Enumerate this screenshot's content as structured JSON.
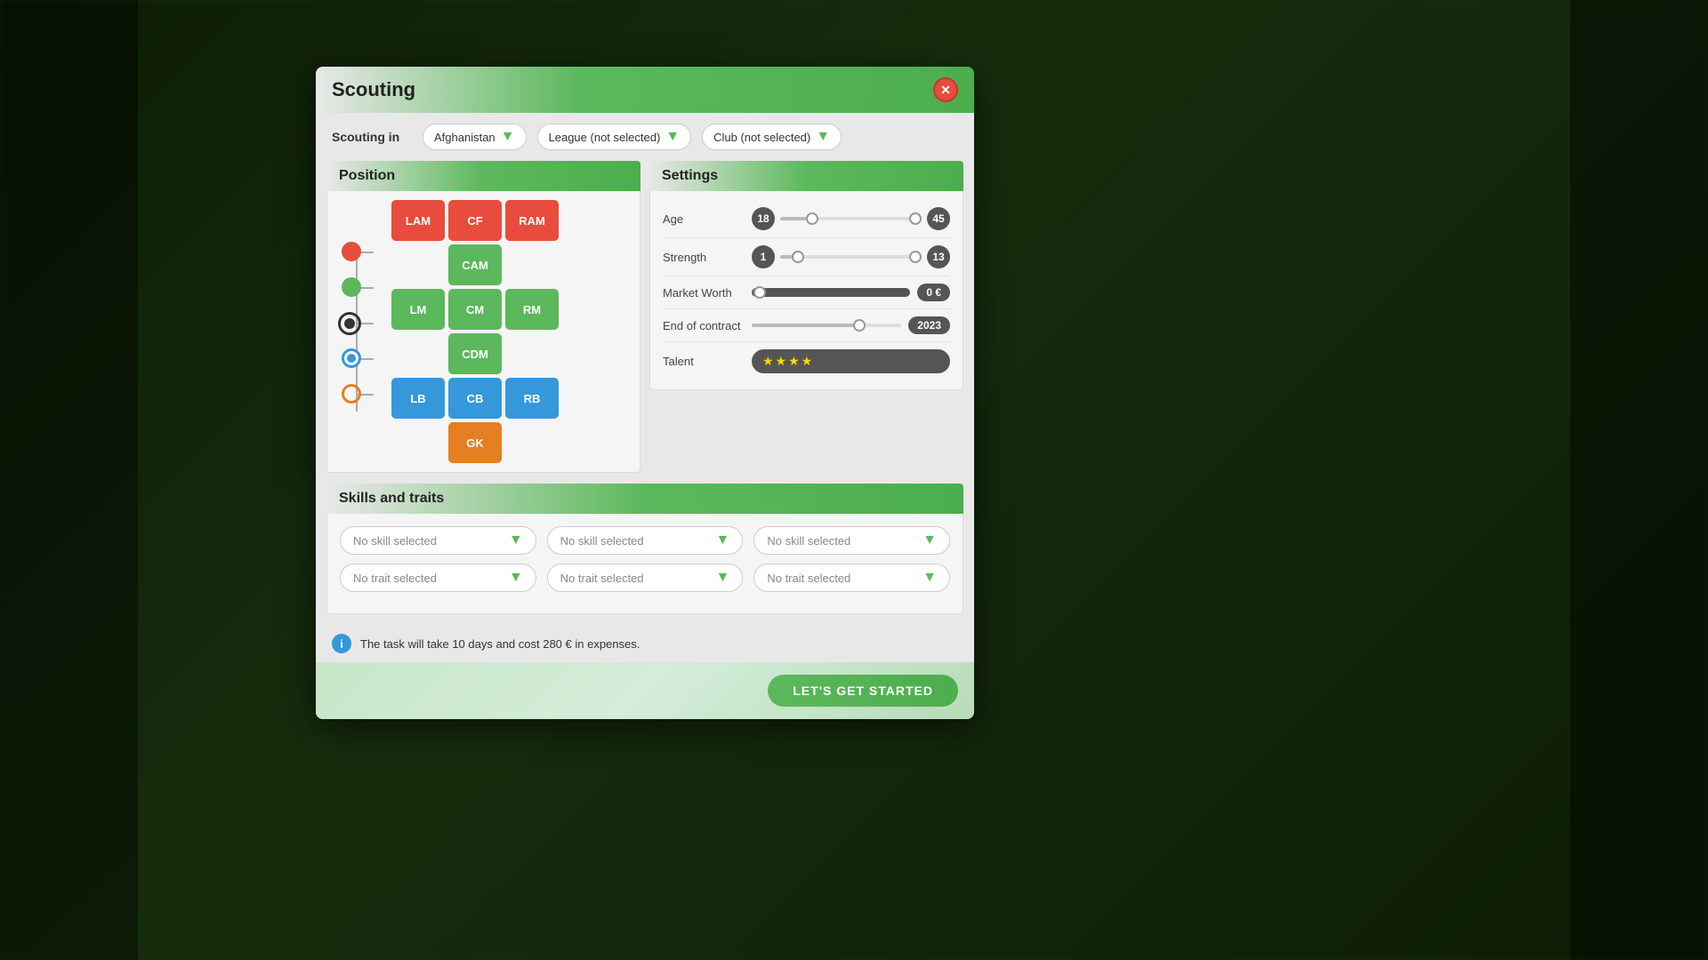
{
  "modal": {
    "title": "Scouting",
    "close_label": "✕"
  },
  "scouting_in": {
    "label": "Scouting in",
    "country": "Afghanistan",
    "league": "League (not selected)",
    "club": "Club (not selected)"
  },
  "position": {
    "panel_title": "Position",
    "positions": [
      {
        "id": "LAM",
        "label": "LAM",
        "color": "red-pos",
        "col": 1,
        "row": 1
      },
      {
        "id": "CF",
        "label": "CF",
        "color": "red-pos",
        "col": 2,
        "row": 1
      },
      {
        "id": "RAM",
        "label": "RAM",
        "color": "red-pos",
        "col": 3,
        "row": 1
      },
      {
        "id": "CAM",
        "label": "CAM",
        "color": "green-pos",
        "col": 2,
        "row": 2
      },
      {
        "id": "LM",
        "label": "LM",
        "color": "green-pos",
        "col": 1,
        "row": 3
      },
      {
        "id": "CM",
        "label": "CM",
        "color": "green-pos",
        "col": 2,
        "row": 3
      },
      {
        "id": "RM",
        "label": "RM",
        "color": "green-pos",
        "col": 3,
        "row": 3
      },
      {
        "id": "CDM",
        "label": "CDM",
        "color": "green-pos",
        "col": 2,
        "row": 4
      },
      {
        "id": "LB",
        "label": "LB",
        "color": "blue-pos",
        "col": 1,
        "row": 5
      },
      {
        "id": "CB",
        "label": "CB",
        "color": "blue-pos",
        "col": 2,
        "row": 5
      },
      {
        "id": "RB",
        "label": "RB",
        "color": "blue-pos",
        "col": 3,
        "row": 5
      },
      {
        "id": "GK",
        "label": "GK",
        "color": "orange-pos",
        "col": 2,
        "row": 6
      }
    ]
  },
  "settings": {
    "panel_title": "Settings",
    "age": {
      "label": "Age",
      "min": 18,
      "max": 45
    },
    "strength": {
      "label": "Strength",
      "min": 1,
      "max": 13
    },
    "market_worth": {
      "label": "Market Worth",
      "value": "0 €"
    },
    "end_of_contract": {
      "label": "End of contract",
      "value": "2023"
    },
    "talent": {
      "label": "Talent",
      "stars": "★★★★"
    }
  },
  "skills_traits": {
    "panel_title": "Skills and traits",
    "skill1": "No skill selected",
    "skill2": "No skill selected",
    "skill3": "No skill selected",
    "trait1": "No trait selected",
    "trait2": "No trait selected",
    "trait3": "No trait selected"
  },
  "info": {
    "icon": "i",
    "text": "The task will take 10 days and cost 280 € in expenses."
  },
  "footer": {
    "start_label": "LET'S GET STARTED"
  }
}
